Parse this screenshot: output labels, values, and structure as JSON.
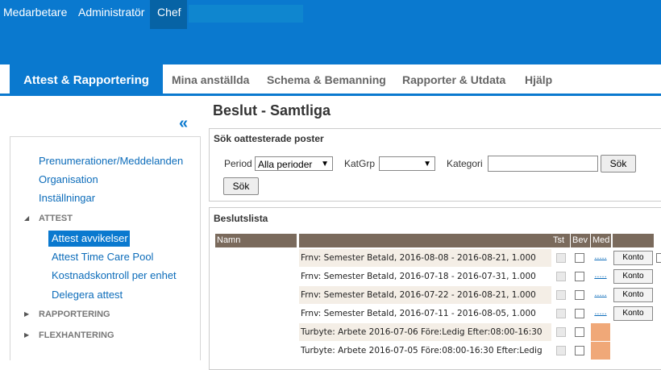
{
  "roles": [
    {
      "label": "Medarbetare"
    },
    {
      "label": "Administratör"
    },
    {
      "label": "Chef"
    }
  ],
  "nav": {
    "tabs": [
      {
        "label": "Attest & Rapportering"
      },
      {
        "label": "Mina anställda"
      },
      {
        "label": "Schema & Bemanning"
      },
      {
        "label": "Rapporter & Utdata"
      },
      {
        "label": "Hjälp"
      }
    ]
  },
  "sidebar": {
    "collapse_icon": "«",
    "links": [
      {
        "label": "Prenumerationer/Meddelanden"
      },
      {
        "label": "Organisation"
      },
      {
        "label": "Inställningar"
      }
    ],
    "attest_header": "ATTEST",
    "attest_items": [
      {
        "label": "Attest avvikelser"
      },
      {
        "label": "Attest Time Care Pool"
      },
      {
        "label": "Kostnadskontroll per enhet"
      },
      {
        "label": "Delegera attest"
      }
    ],
    "rapportering_header": "RAPPORTERING",
    "flex_header": "FLEXHANTERING"
  },
  "page": {
    "title": "Beslut - Samtliga"
  },
  "search": {
    "title": "Sök oattesterade poster",
    "period_label": "Period",
    "period_value": "Alla perioder",
    "katgrp_label": "KatGrp",
    "katgrp_value": "",
    "kategori_label": "Kategori",
    "kategori_value": "",
    "search_btn": "Sök",
    "search_btn2": "Sök"
  },
  "list": {
    "title": "Beslutslista",
    "headers": {
      "namn": "Namn",
      "tst": "Tst",
      "bev": "Bev",
      "med": "Med"
    },
    "rows": [
      {
        "text": "Frnv: Semester Betald, 2016-08-08 - 2016-08-21, 1.000",
        "med": ".....",
        "konto": "Konto"
      },
      {
        "text": "Frnv: Semester Betald, 2016-07-18 - 2016-07-31, 1.000",
        "med": ".....",
        "konto": "Konto"
      },
      {
        "text": "Frnv: Semester Betald, 2016-07-22 - 2016-08-21, 1.000",
        "med": ".....",
        "konto": "Konto"
      },
      {
        "text": "Frnv: Semester Betald, 2016-07-11 - 2016-08-05, 1.000",
        "med": ".....",
        "konto": "Konto"
      },
      {
        "text": "Turbyte: Arbete 2016-07-06 Före:Ledig Efter:08:00-16:30"
      },
      {
        "text": "Turbyte: Arbete 2016-07-05 Före:08:00-16:30 Efter:Ledig"
      }
    ]
  },
  "colors": {
    "brand": "#0a79cf",
    "header_row": "#7a6a5c",
    "row_shade": "#f4eee6",
    "med_highlight": "#f0a878"
  }
}
